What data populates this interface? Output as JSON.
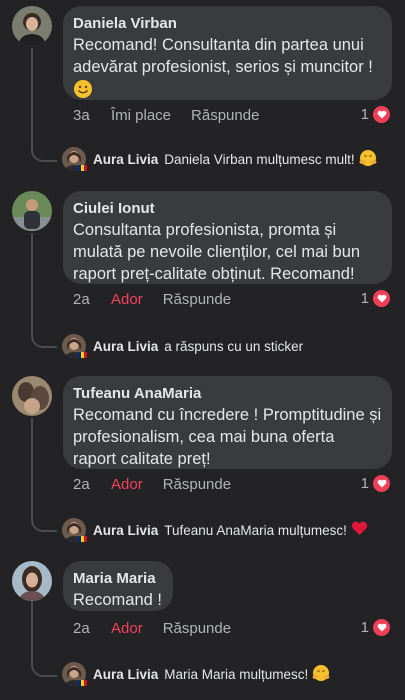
{
  "comments": [
    {
      "author": "Daniela Virban",
      "text": "Recomand! Consultanta din partea unui\nadevărat profesionist, serios și muncitor !",
      "time": "3a",
      "like_label": "Îmi place",
      "reply_label": "Răspunde",
      "reaction_count": "1",
      "reply": {
        "author": "Aura Livia",
        "text": "Daniela Virban mulțumesc mult!",
        "emoji": "hugging"
      }
    },
    {
      "author": "Ciulei Ionut",
      "text": "Consultanta profesionista, promta și\nmulată pe nevoile clienților, cel mai bun\nraport preț-calitate obținut. Recomand!",
      "time": "2a",
      "like_label": "Ador",
      "reply_label": "Răspunde",
      "reaction_count": "1",
      "reply": {
        "author": "Aura Livia",
        "text": "a răspuns cu un sticker"
      }
    },
    {
      "author": "Tufeanu AnaMaria",
      "text": "Recomand cu încredere ! Promptitudine și\nprofesionalism, cea mai buna oferta\nraport calitate preț!",
      "time": "2a",
      "like_label": "Ador",
      "reply_label": "Răspunde",
      "reaction_count": "1",
      "reply": {
        "author": "Aura Livia",
        "text": "Tufeanu AnaMaria mulțumesc!",
        "emoji": "heart"
      }
    },
    {
      "author": "Maria Maria",
      "text": "Recomand !",
      "time": "2a",
      "like_label": "Ador",
      "reply_label": "Răspunde",
      "reaction_count": "1",
      "reply": {
        "author": "Aura Livia",
        "text": "Maria Maria mulțumesc!",
        "emoji": "hugging"
      }
    }
  ],
  "colors": {
    "background": "#232325",
    "bubble": "#3a3b3c",
    "love_red": "#f3425f",
    "muted": "#b0b3b8"
  }
}
